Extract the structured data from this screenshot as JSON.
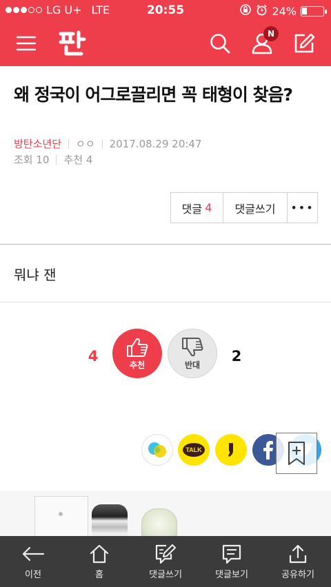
{
  "status_bar": {
    "carrier": "LG U+",
    "network": "LTE",
    "time": "20:55",
    "battery_percent": "24%",
    "battery_level": 0.24,
    "signal_bars_filled": 3,
    "signal_bars_total": 5
  },
  "app_bar": {
    "logo_text": "판",
    "notification_badge": "N",
    "accent_color": "#ee3e4b",
    "icons": [
      "menu-icon",
      "search-icon",
      "user-icon",
      "edit-icon"
    ]
  },
  "post": {
    "title": "왜 정국이 어그로끌리면 꼭 태형이 찾음?",
    "category": "방탄소년단",
    "author": "ㅇㅇ",
    "date": "2017.08.29 20:47",
    "views_label": "조회 10",
    "recommend_label": "추천 4",
    "body": "뭐냐 잰"
  },
  "comment_bar": {
    "comments_label": "댓글",
    "comments_count": "4",
    "write_label": "댓글쓰기",
    "more_label": "•••"
  },
  "votes": {
    "up_count": "4",
    "up_label": "추천",
    "down_label": "반대",
    "down_count": "2"
  },
  "share": {
    "icons": [
      "twitter-like-icon",
      "kakaotalk-icon",
      "kakaostory-icon",
      "facebook-icon",
      "twitter-icon"
    ],
    "kakaotalk_text": "TALK",
    "bookmark_icon": "bookmark-add-icon"
  },
  "tab_bar": {
    "items": [
      {
        "label": "이전",
        "icon": "back-arrow-icon"
      },
      {
        "label": "홈",
        "icon": "home-icon"
      },
      {
        "label": "댓글쓰기",
        "icon": "write-comment-icon"
      },
      {
        "label": "댓글보기",
        "icon": "view-comments-icon"
      },
      {
        "label": "공유하기",
        "icon": "share-icon"
      }
    ]
  }
}
